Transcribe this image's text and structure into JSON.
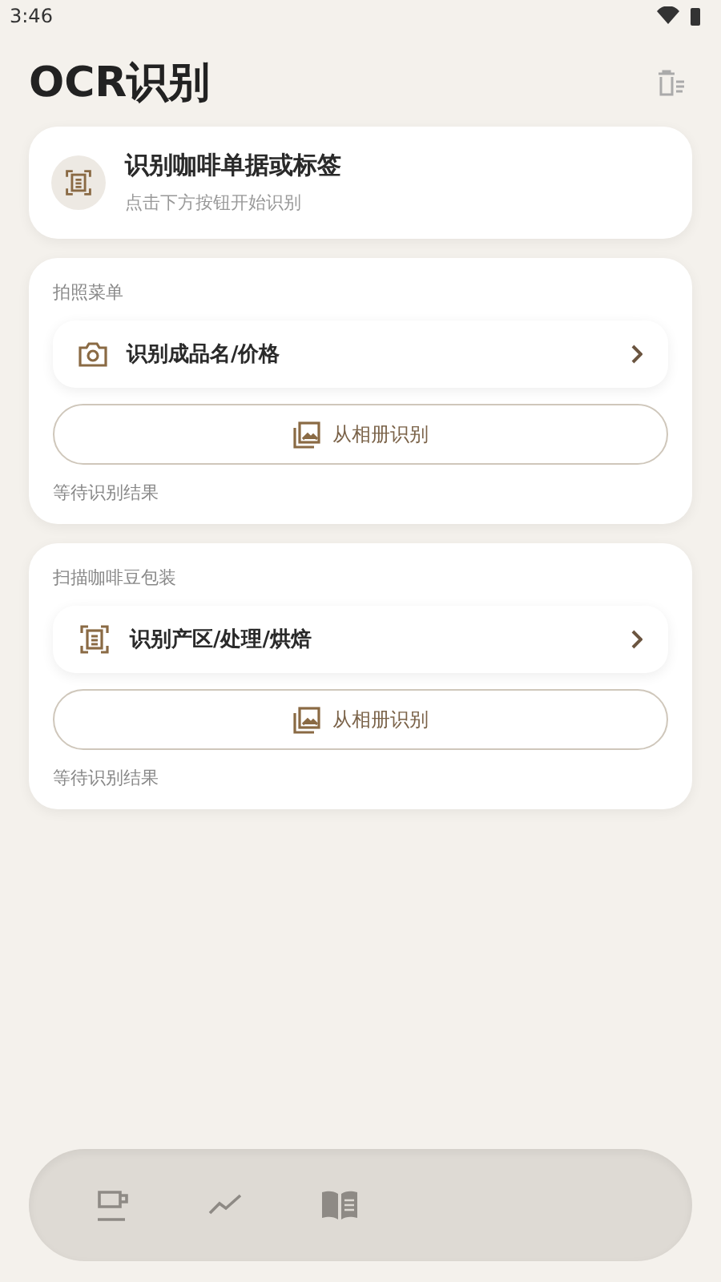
{
  "status_bar": {
    "time": "3:46"
  },
  "header": {
    "title": "OCR识别"
  },
  "intro": {
    "title": "识别咖啡单据或标签",
    "subtitle": "点击下方按钮开始识别"
  },
  "sections": [
    {
      "label": "拍照菜单",
      "action": {
        "kind": "camera",
        "label": "识别成品名/价格"
      },
      "album_button": "从相册识别",
      "result": "等待识别结果"
    },
    {
      "label": "扫描咖啡豆包装",
      "action": {
        "kind": "scan",
        "label": "识别产区/处理/烘焙"
      },
      "album_button": "从相册识别",
      "result": "等待识别结果"
    }
  ],
  "nav": [
    {
      "kind": "cup"
    },
    {
      "kind": "trend"
    },
    {
      "kind": "book"
    }
  ]
}
